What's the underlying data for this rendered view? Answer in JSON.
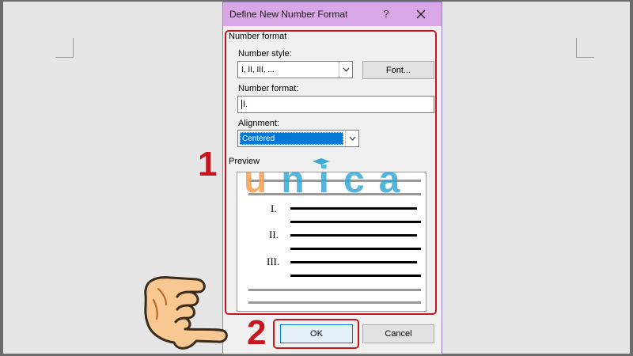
{
  "dialog": {
    "title": "Define New Number Format",
    "help": "?",
    "group_number_format": "Number format",
    "number_style_label": "Number style:",
    "number_style_value": "I, II, III, ...",
    "font_button": "Font...",
    "number_format_label": "Number format:",
    "number_format_value": "I.",
    "alignment_label": "Alignment:",
    "alignment_value": "Centered",
    "preview_label": "Preview",
    "preview_numbers": [
      "I.",
      "II.",
      "III."
    ],
    "ok_button": "OK",
    "cancel_button": "Cancel"
  },
  "annotations": {
    "step1": "1",
    "step2": "2"
  },
  "watermark": {
    "u": "u",
    "rest": "nica"
  },
  "colors": {
    "titlebar": "#d9a7e6",
    "annotation_red": "#c4161c",
    "selection_blue": "#0078d7"
  }
}
